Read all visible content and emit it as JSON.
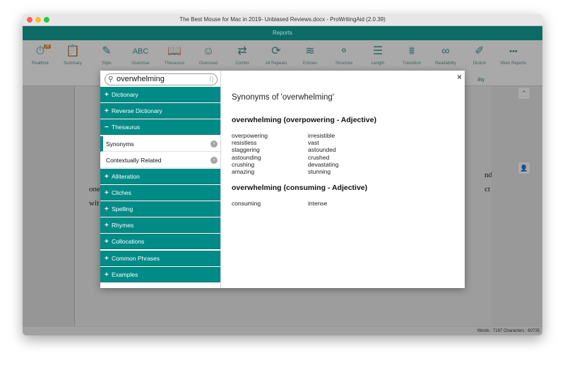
{
  "window": {
    "title": "The Best Mouse for Mac in 2019- Unbiased Reviews.docx - ProWritingAid (2.0.39)"
  },
  "reports_bar": {
    "label": "Reports"
  },
  "toolbar": {
    "realtime_badge": "28",
    "items": [
      {
        "label": "Realtime",
        "icon": "stopwatch-icon",
        "glyph": "⏱"
      },
      {
        "label": "Summary",
        "icon": "clipboard-icon",
        "glyph": "📋"
      },
      {
        "label": "Style",
        "icon": "pen-icon",
        "glyph": "✎"
      },
      {
        "label": "Grammar",
        "icon": "abc-icon",
        "glyph": "ABC"
      },
      {
        "label": "Thesaurus",
        "icon": "book-icon",
        "glyph": "📖"
      },
      {
        "label": "Overused",
        "icon": "face-icon",
        "glyph": "☺"
      },
      {
        "label": "Combo",
        "icon": "shuffle-icon",
        "glyph": "⇄"
      },
      {
        "label": "All Repeats",
        "icon": "repeat-icon",
        "glyph": "⟳"
      },
      {
        "label": "Echoes",
        "icon": "waveform-icon",
        "glyph": "≋"
      },
      {
        "label": "Structure",
        "icon": "network-icon",
        "glyph": "⚬"
      },
      {
        "label": "Length",
        "icon": "bars-icon",
        "glyph": "☰"
      },
      {
        "label": "Transition",
        "icon": "bridge-icon",
        "glyph": "⩩"
      },
      {
        "label": "Readability",
        "icon": "glasses-icon",
        "glyph": "∞"
      },
      {
        "label": "Diction",
        "icon": "pencil-icon",
        "glyph": "✐"
      },
      {
        "label": "More Reports",
        "icon": "more-icon",
        "glyph": "•••"
      }
    ]
  },
  "background_doc": {
    "hint_right": "ility",
    "line_end1": "nd",
    "line_start2": "one",
    "line_end2": "ct",
    "line_start3": "wit"
  },
  "statusbar": {
    "text": "Words : 7197 Characters : 60735"
  },
  "modal": {
    "search": {
      "value": "overwhelming",
      "placeholder": ""
    },
    "nav": [
      {
        "label": "Dictionary",
        "sign": "+"
      },
      {
        "label": "Reverse Dictionary",
        "sign": "+"
      },
      {
        "label": "Thesaurus",
        "sign": "−"
      }
    ],
    "sub": [
      {
        "label": "Synonyms"
      },
      {
        "label": "Contextually Related"
      }
    ],
    "nav2": [
      {
        "label": "Alliteration",
        "sign": "+"
      },
      {
        "label": "Cliches",
        "sign": "+"
      },
      {
        "label": "Spelling",
        "sign": "+"
      },
      {
        "label": "Rhymes",
        "sign": "+"
      },
      {
        "label": "Collocations",
        "sign": "+"
      },
      {
        "label": "Common Phrases",
        "sign": "+"
      },
      {
        "label": "Examples",
        "sign": "+"
      }
    ],
    "close_label": "×",
    "title": "Synonyms of 'overwhelming'",
    "groups": [
      {
        "heading": "overwhelming (overpowering - Adjective)",
        "rows": [
          [
            "overpowering",
            "irresistible"
          ],
          [
            "resistless",
            "vast"
          ],
          [
            "staggering",
            "astounded"
          ],
          [
            "astounding",
            "crushed"
          ],
          [
            "crushing",
            "devastating"
          ],
          [
            "amazing",
            "stunning"
          ]
        ]
      },
      {
        "heading": "overwhelming (consuming - Adjective)",
        "rows": [
          [
            "consuming",
            "intense"
          ]
        ]
      }
    ]
  }
}
